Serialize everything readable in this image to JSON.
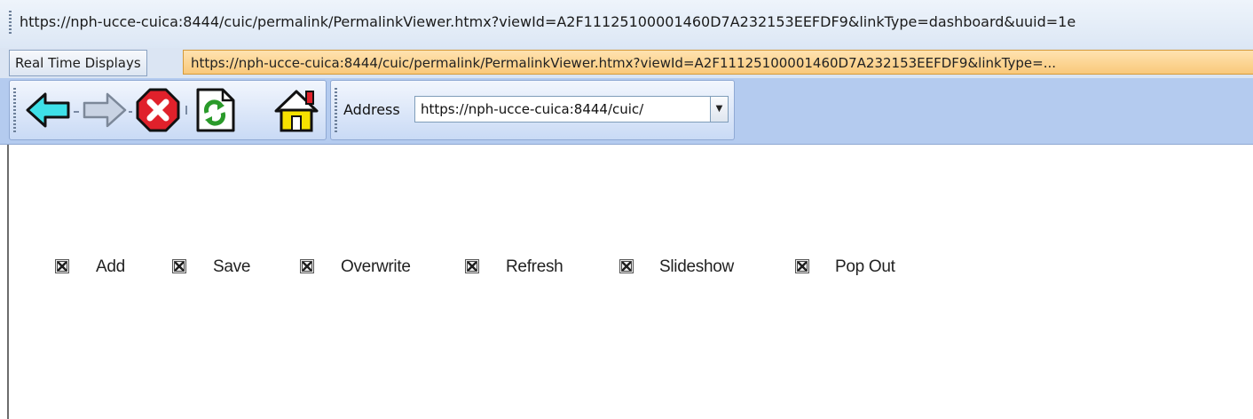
{
  "window": {
    "url_title": "https://nph-ucce-cuica:8444/cuic/permalink/PermalinkViewer.htmx?viewId=A2F11125100001460D7A232153EEFDF9&linkType=dashboard&uuid=1e"
  },
  "tabs": [
    {
      "label": "Real Time Displays"
    },
    {
      "label": "https://nph-ucce-cuica:8444/cuic/permalink/PermalinkViewer.htmx?viewId=A2F11125100001460D7A232153EEFDF9&linkType=..."
    }
  ],
  "toolbar": {
    "back_icon": "back-arrow-icon",
    "forward_icon": "forward-arrow-icon",
    "stop_icon": "stop-icon",
    "refresh_icon": "refresh-icon",
    "home_icon": "home-icon",
    "address_label": "Address",
    "address_value": "https://nph-ucce-cuica:8444/cuic/"
  },
  "actions": [
    {
      "label": "Add"
    },
    {
      "label": "Save"
    },
    {
      "label": "Overwrite"
    },
    {
      "label": "Refresh"
    },
    {
      "label": "Slideshow"
    },
    {
      "label": "Pop Out"
    }
  ],
  "colors": {
    "toolbar_bg": "#b4cbef",
    "active_tab": "#f9c97b",
    "back_arrow": "#3ee0e8",
    "stop_red": "#e0212b",
    "refresh_green": "#2a9a2a",
    "home_yellow": "#f6e100"
  }
}
